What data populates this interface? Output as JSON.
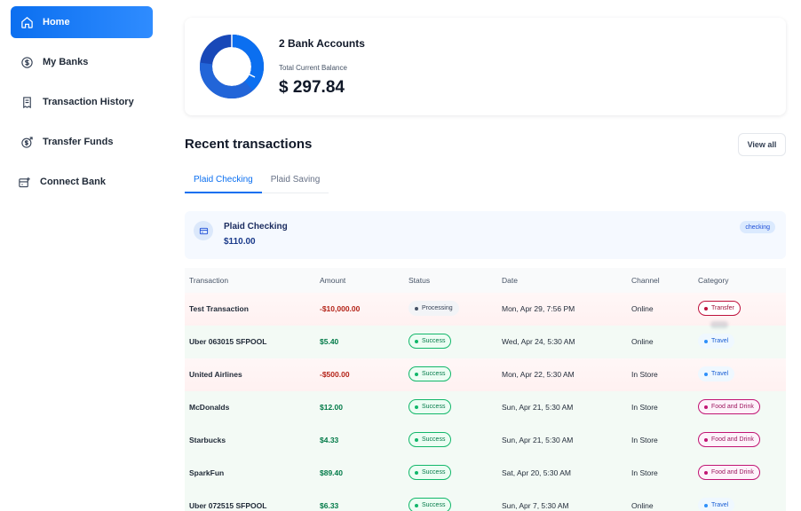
{
  "sidebar": {
    "items": [
      {
        "label": "Home",
        "icon": "home-icon"
      },
      {
        "label": "My Banks",
        "icon": "dollar-circle-icon"
      },
      {
        "label": "Transaction History",
        "icon": "receipt-icon"
      },
      {
        "label": "Transfer Funds",
        "icon": "money-send-icon"
      },
      {
        "label": "Connect Bank",
        "icon": "connect-bank-icon"
      }
    ]
  },
  "balance": {
    "accounts_label": "2 Bank Accounts",
    "current_label": "Total Current Balance",
    "current_value": "$ 297.84",
    "donut_colors": [
      "#0b6ff0",
      "#2265d8",
      "#1848b8"
    ]
  },
  "recent": {
    "title": "Recent transactions",
    "view_all": "View all",
    "tabs": [
      "Plaid Checking",
      "Plaid Saving"
    ],
    "active_tab": "Plaid Checking"
  },
  "account": {
    "name": "Plaid Checking",
    "amount": "$110.00",
    "badge": "checking"
  },
  "table": {
    "headers": [
      "Transaction",
      "Amount",
      "Status",
      "Date",
      "Channel",
      "Category"
    ],
    "rows": [
      {
        "name": "Test Transaction",
        "amount": "-$10,000.00",
        "status": "Processing",
        "date": "Mon, Apr 29, 7:56 PM",
        "channel": "Online",
        "category": "Transfer"
      },
      {
        "name": "Uber 063015 SFPOOL",
        "amount": "$5.40",
        "status": "Success",
        "date": "Wed, Apr 24, 5:30 AM",
        "channel": "Online",
        "category": "Travel"
      },
      {
        "name": "United Airlines",
        "amount": "-$500.00",
        "status": "Success",
        "date": "Mon, Apr 22, 5:30 AM",
        "channel": "In Store",
        "category": "Travel"
      },
      {
        "name": "McDonalds",
        "amount": "$12.00",
        "status": "Success",
        "date": "Sun, Apr 21, 5:30 AM",
        "channel": "In Store",
        "category": "Food and Drink"
      },
      {
        "name": "Starbucks",
        "amount": "$4.33",
        "status": "Success",
        "date": "Sun, Apr 21, 5:30 AM",
        "channel": "In Store",
        "category": "Food and Drink"
      },
      {
        "name": "SparkFun",
        "amount": "$89.40",
        "status": "Success",
        "date": "Sat, Apr 20, 5:30 AM",
        "channel": "In Store",
        "category": "Food and Drink"
      },
      {
        "name": "Uber 072515 SFPOOL",
        "amount": "$6.33",
        "status": "Success",
        "date": "Sun, Apr 7, 5:30 AM",
        "channel": "Online",
        "category": "Travel"
      }
    ]
  },
  "colors": {
    "accent": "#0b6ff0",
    "negative": "#b42318",
    "positive": "#027a48"
  }
}
